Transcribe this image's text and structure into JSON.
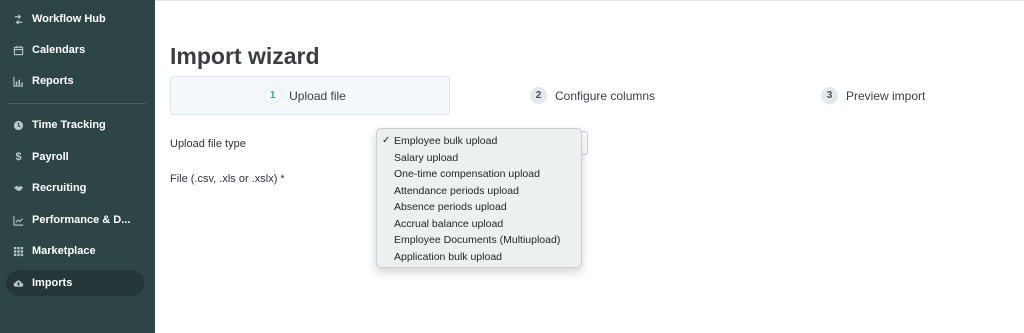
{
  "sidebar": {
    "items": [
      {
        "label": "Workflow Hub",
        "icon": "workflow-icon"
      },
      {
        "label": "Calendars",
        "icon": "calendar-icon"
      },
      {
        "label": "Reports",
        "icon": "chart-icon"
      },
      {
        "label": "Time Tracking",
        "icon": "clock-icon"
      },
      {
        "label": "Payroll",
        "icon": "dollar-icon"
      },
      {
        "label": "Recruiting",
        "icon": "handshake-icon"
      },
      {
        "label": "Performance & D...",
        "icon": "trend-icon"
      },
      {
        "label": "Marketplace",
        "icon": "grid-icon"
      },
      {
        "label": "Imports",
        "icon": "cloud-upload-icon",
        "active": true
      }
    ]
  },
  "page": {
    "title": "Import wizard"
  },
  "steps": [
    {
      "number": "1",
      "label": "Upload file",
      "active": true
    },
    {
      "number": "2",
      "label": "Configure columns",
      "active": false
    },
    {
      "number": "3",
      "label": "Preview import",
      "active": false
    }
  ],
  "form": {
    "file_type_label": "Upload file type",
    "file_label": "File (.csv, .xls or .xslx) *"
  },
  "dropdown": {
    "checkmark": "✓",
    "selected_index": 0,
    "options": [
      "Employee bulk upload",
      "Salary upload",
      "One-time compensation upload",
      "Attendance periods upload",
      "Absence periods upload",
      "Accrual balance upload",
      "Employee Documents (Multiupload)",
      "Application bulk upload"
    ]
  },
  "colors": {
    "sidebar_bg": "#2e4547",
    "accent": "#1ba8b5"
  }
}
